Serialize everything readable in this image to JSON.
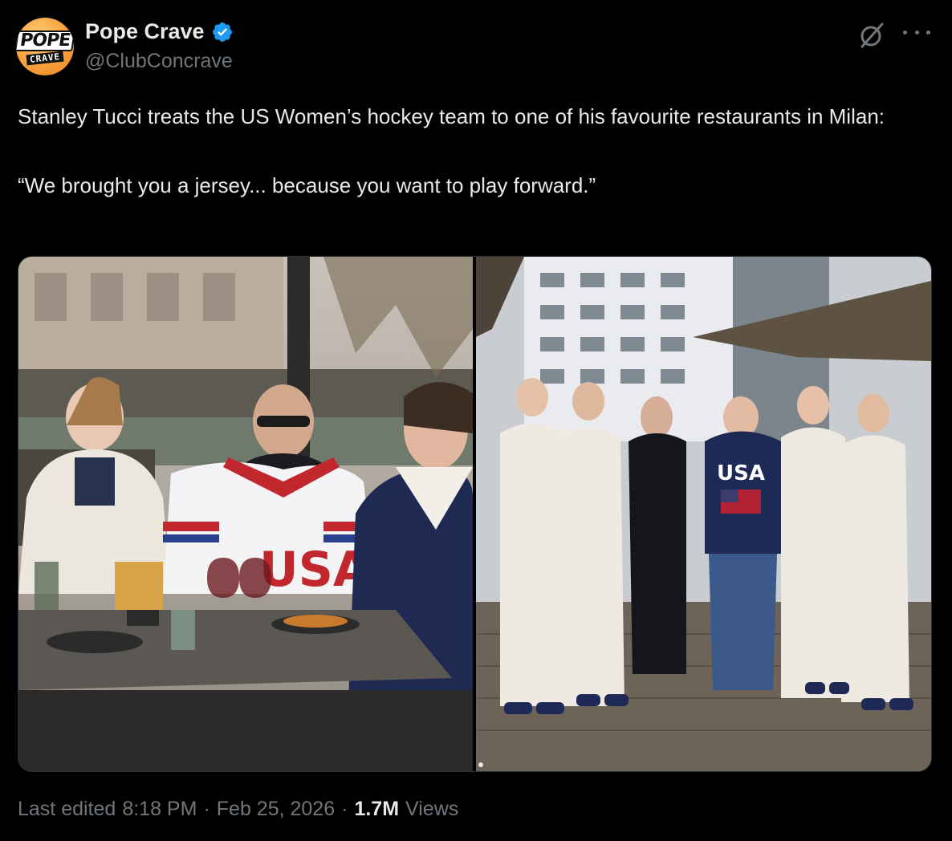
{
  "account": {
    "avatar_top": "POPE",
    "avatar_bottom": "CRAVE",
    "display_name": "Pope Crave",
    "handle": "@ClubConcrave",
    "verified_color": "#1d9bf0"
  },
  "tweet": {
    "line1": "Stanley Tucci treats the US Women’s hockey team to one of his favourite restaurants in Milan:",
    "line2": "“We brought you a jersey... because you want to play forward.”"
  },
  "media": {
    "images": [
      {
        "subject": "restaurant-table-jersey-photo",
        "jersey_letters": "USA"
      },
      {
        "subject": "team-group-photo",
        "sweater_text": "USA"
      }
    ]
  },
  "meta": {
    "edited_label": "Last edited",
    "time": "8:18 PM",
    "separator": "·",
    "date": "Feb 25, 2026",
    "views_count": "1.7M",
    "views_label": "Views"
  },
  "icons": [
    "verified-badge-icon",
    "grok-icon",
    "more-options-icon"
  ],
  "colors": {
    "background": "#000000",
    "primary_text": "#e7e9ea",
    "secondary_text": "#71767b",
    "border": "#2f3336"
  }
}
